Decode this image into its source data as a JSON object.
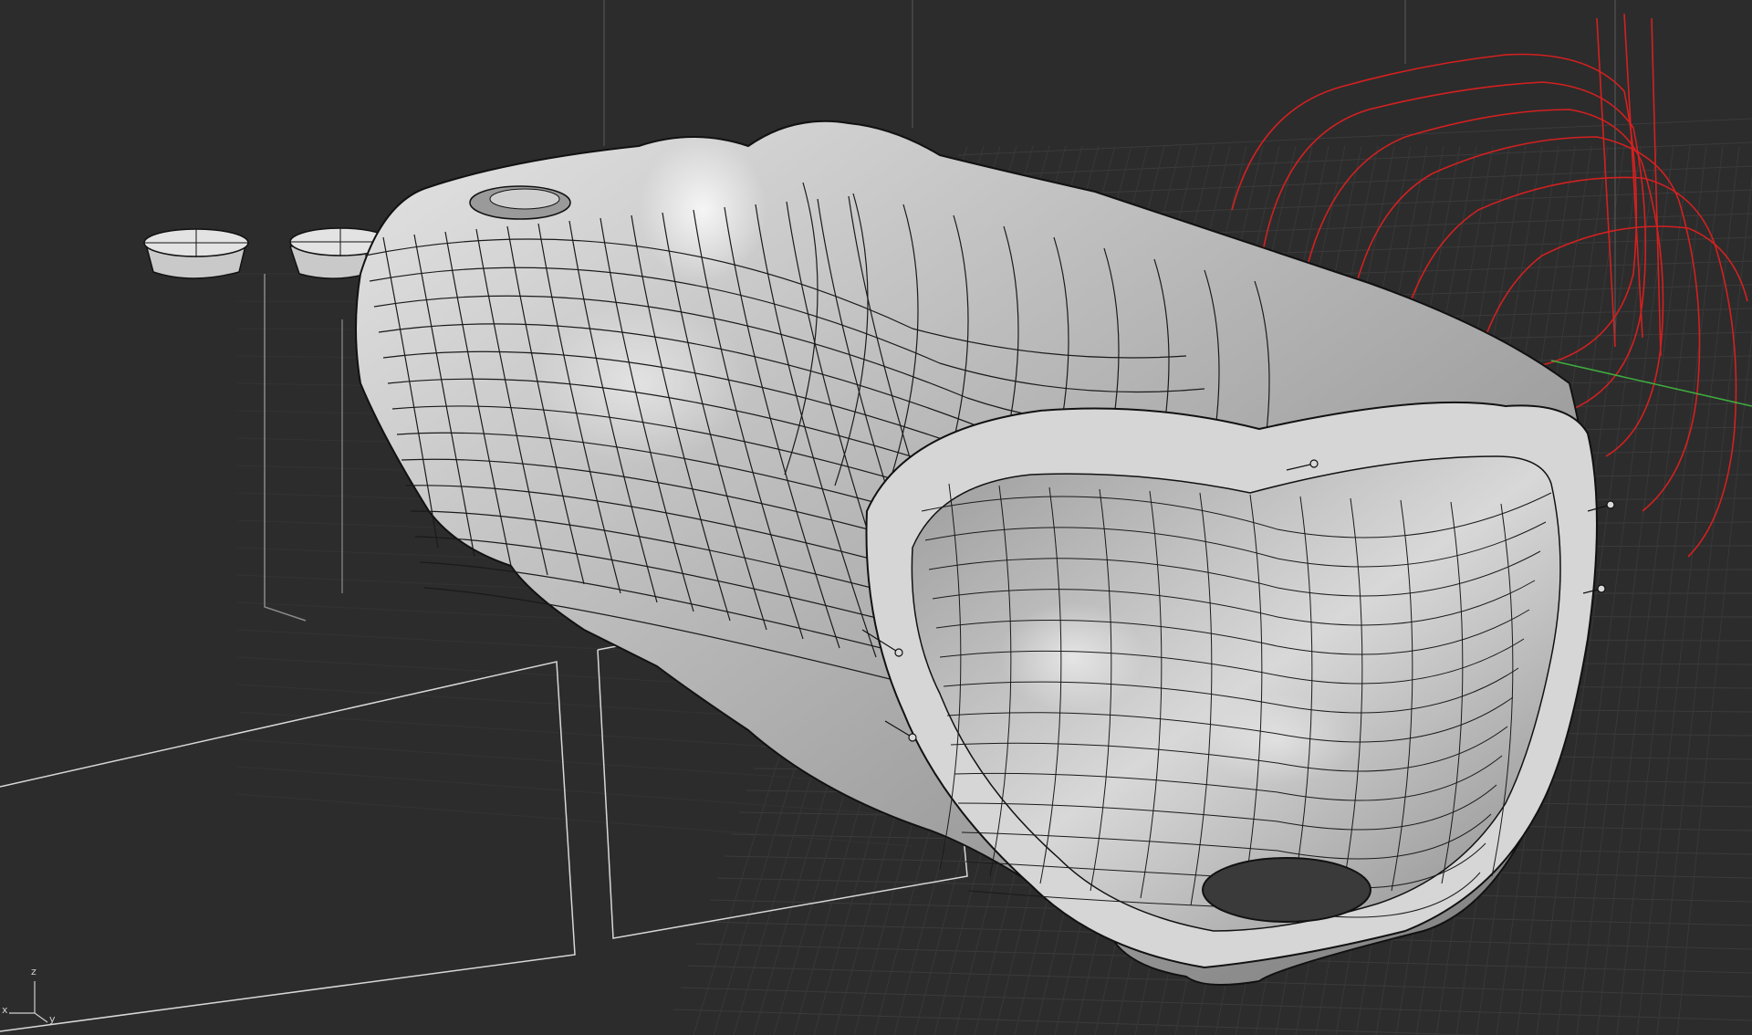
{
  "viewport": {
    "background": "#2c2c2c",
    "grid_color": "#3a3a3a",
    "grid_major_color": "#454545",
    "model_color": "#bdbdbd",
    "isocurve_color": "#1a1a1a",
    "curve_color": "#d42020",
    "green_axis_color": "#3fae3f",
    "box_edge_color": "#e6e6e6"
  },
  "axis_widget": {
    "z_label": "z",
    "y_label": "y",
    "x_label": "x"
  }
}
